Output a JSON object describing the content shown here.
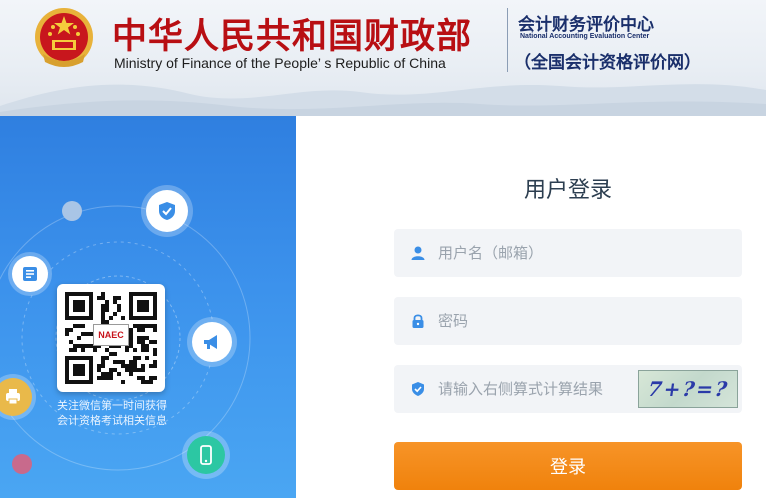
{
  "header": {
    "title_cn": "中华人民共和国财政部",
    "title_en": "Ministry of Finance of the People’ s Republic of China",
    "center_cn": "会计财务评价中心",
    "center_en": "National Accounting Evaluation Center",
    "center_sub": "（全国会计资格评价网）",
    "emblem_icon": "national-emblem-icon"
  },
  "left_panel": {
    "qr_badge": "NAEC",
    "caption_line1": "关注微信第一时间获得",
    "caption_line2": "会计资格考试相关信息",
    "icons": [
      "shield-check-icon",
      "document-icon",
      "megaphone-icon",
      "mobile-phone-icon",
      "printer-icon"
    ]
  },
  "login": {
    "title": "用户登录",
    "username_placeholder": "用户名（邮箱）",
    "password_placeholder": "密码",
    "captcha_placeholder": "请输入右侧算式计算结果",
    "captcha_text": "7+?=?",
    "submit_label": "登录"
  },
  "colors": {
    "brand_red": "#b80f13",
    "navy": "#1a2f6b",
    "panel_blue": "#3c92ec",
    "accent_orange": "#f0820c",
    "icon_blue": "#3a8ee6"
  }
}
